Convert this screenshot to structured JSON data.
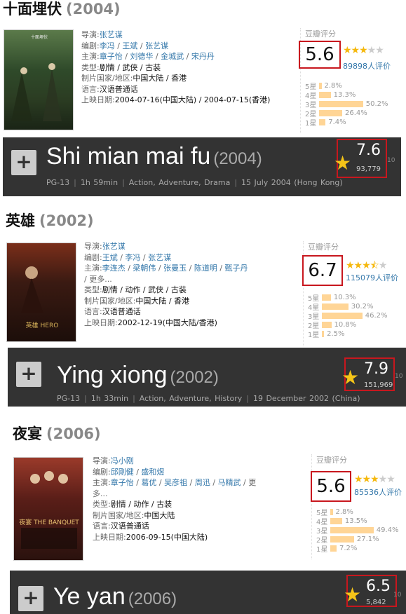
{
  "movies": [
    {
      "title": "十面埋伏",
      "year": "(2004)",
      "director": "张艺谋",
      "writers": [
        "李冯",
        "王斌",
        "张艺谋"
      ],
      "cast": [
        "章子怡",
        "刘德华",
        "金城武",
        "宋丹丹"
      ],
      "genres": "剧情 / 武侠 / 古装",
      "country": "中国大陆 / 香港",
      "language": "汉语普通话",
      "release": "2004-07-16(中国大陆) / 2004-07-15(香港)",
      "more": "",
      "douban_label": "豆瓣评分",
      "score": "5.6",
      "stars": 3,
      "stars_display": 0.56,
      "count": "89898人评价",
      "hist": [
        {
          "k": "5星",
          "p": "2.8%",
          "v": 2.8
        },
        {
          "k": "4星",
          "p": "13.3%",
          "v": 13.3
        },
        {
          "k": "3星",
          "p": "50.2%",
          "v": 50.2
        },
        {
          "k": "2星",
          "p": "26.4%",
          "v": 26.4
        },
        {
          "k": "1星",
          "p": "7.4%",
          "v": 7.4
        }
      ],
      "imdb": {
        "title": "Shi mian mai fu",
        "year": "(2004)",
        "rated": "PG-13",
        "runtime": "1h 59min",
        "genres": "Action, Adventure, Drama",
        "release": "15 July 2004 (Hong Kong)",
        "rating": "7.6",
        "votes": "93,779",
        "scale": "10"
      }
    },
    {
      "title": "英雄",
      "year": "(2002)",
      "director": "张艺谋",
      "writers": [
        "王斌",
        "李冯",
        "张艺谋"
      ],
      "cast": [
        "李连杰",
        "梁朝伟",
        "张曼玉",
        "陈道明",
        "甄子丹"
      ],
      "genres": "剧情 / 动作 / 武侠 / 古装",
      "country": "中国大陆 / 香港",
      "language": "汉语普通话",
      "release": "2002-12-19(中国大陆/香港)",
      "more": "更多...",
      "douban_label": "豆瓣评分",
      "score": "6.7",
      "stars": 3.5,
      "stars_display": 0.67,
      "count": "115079人评价",
      "hist": [
        {
          "k": "5星",
          "p": "10.3%",
          "v": 10.3
        },
        {
          "k": "4星",
          "p": "30.2%",
          "v": 30.2
        },
        {
          "k": "3星",
          "p": "46.2%",
          "v": 46.2
        },
        {
          "k": "2星",
          "p": "10.8%",
          "v": 10.8
        },
        {
          "k": "1星",
          "p": "2.5%",
          "v": 2.5
        }
      ],
      "imdb": {
        "title": "Ying xiong",
        "year": "(2002)",
        "rated": "PG-13",
        "runtime": "1h 33min",
        "genres": "Action, Adventure, History",
        "release": "19 December 2002 (China)",
        "rating": "7.9",
        "votes": "151,969",
        "scale": "10"
      }
    },
    {
      "title": "夜宴",
      "year": "(2006)",
      "director": "冯小刚",
      "writers": [
        "邱刚健",
        "盛和煜"
      ],
      "cast": [
        "章子怡",
        "葛优",
        "吴彦祖",
        "周迅",
        "马精武"
      ],
      "genres": "剧情 / 动作 / 古装",
      "country": "中国大陆",
      "language": "汉语普通话",
      "release": "2006-09-15(中国大陆)",
      "more": "更多...",
      "douban_label": "豆瓣评分",
      "score": "5.6",
      "stars": 3,
      "stars_display": 0.56,
      "count": "85536人评价",
      "hist": [
        {
          "k": "5星",
          "p": "2.8%",
          "v": 2.8
        },
        {
          "k": "4星",
          "p": "13.5%",
          "v": 13.5
        },
        {
          "k": "3星",
          "p": "49.4%",
          "v": 49.4
        },
        {
          "k": "2星",
          "p": "27.1%",
          "v": 27.1
        },
        {
          "k": "1星",
          "p": "7.2%",
          "v": 7.2
        }
      ],
      "imdb": {
        "title": "Ye yan",
        "year": "(2006)",
        "rated": "",
        "runtime": "",
        "genres": "",
        "release": "",
        "rating": "6.5",
        "votes": "5,842",
        "scale": "10"
      }
    }
  ],
  "labels": {
    "director": "导演:",
    "writers": "编剧:",
    "cast": "主演:",
    "genres": "类型:",
    "country": "制片国家/地区:",
    "language": "语言:",
    "release": "上映日期:"
  },
  "poster_text": [
    "十面埋伏",
    "英雄 HERO",
    "夜宴 THE BANQUET"
  ]
}
